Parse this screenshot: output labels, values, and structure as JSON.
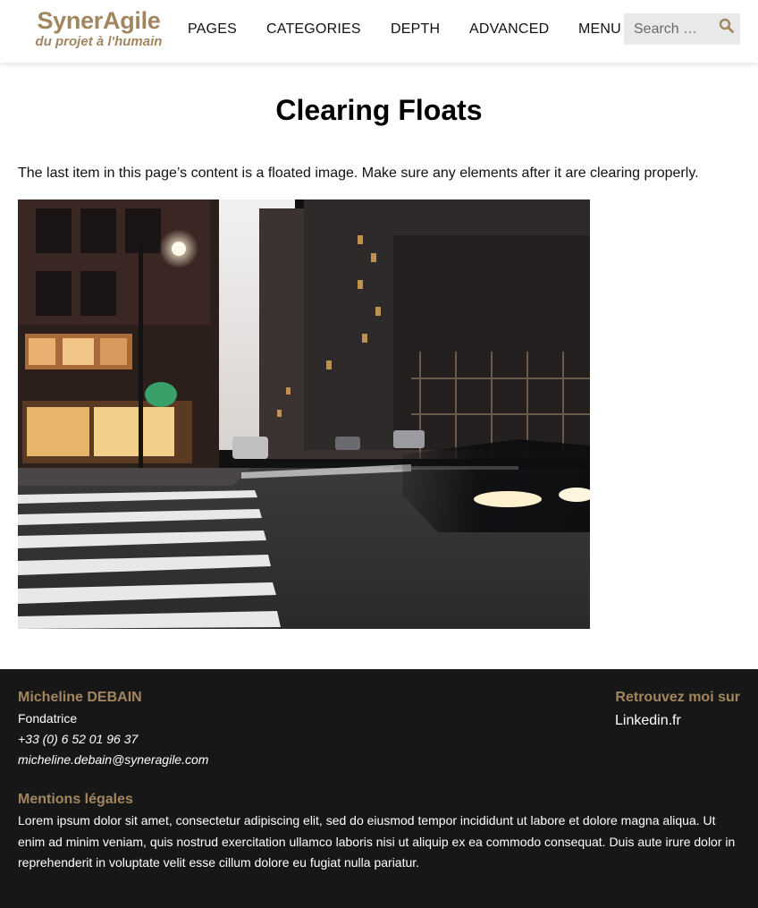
{
  "header": {
    "logo_title": "SynerAgile",
    "logo_tagline": "du projet à l'humain",
    "nav": [
      "PAGES",
      "CATEGORIES",
      "DEPTH",
      "ADVANCED",
      "MENU"
    ],
    "search_placeholder": "Search …",
    "search_icon": "search-icon"
  },
  "main": {
    "title": "Clearing Floats",
    "intro": "The last item in this page’s content is a floated image. Make sure any elements after it are clearing properly.",
    "image": "photo of a city street at dusk with a crosswalk and a blurred car"
  },
  "footer": {
    "name": "Micheline DEBAIN",
    "role": "Fondatrice",
    "phone": "+33 (0) 6 52 01 96 37",
    "email": "micheline.debain@syneragile.com",
    "find_me": "Retrouvez moi sur",
    "link": "Linkedin.fr",
    "legal_title": "Mentions légales",
    "legal_text": "Lorem ipsum dolor sit amet, consectetur adipiscing elit, sed do eiusmod tempor incididunt ut labore et dolore magna aliqua. Ut enim ad minim veniam, quis nostrud exercitation ullamco laboris nisi ut aliquip ex ea commodo consequat. Duis aute irure dolor in reprehenderit in voluptate velit esse cillum dolore eu fugiat nulla pariatur."
  },
  "colors": {
    "brand": "#a2865f",
    "footer_bg": "#171717",
    "search_bg": "#e9e9e9"
  }
}
